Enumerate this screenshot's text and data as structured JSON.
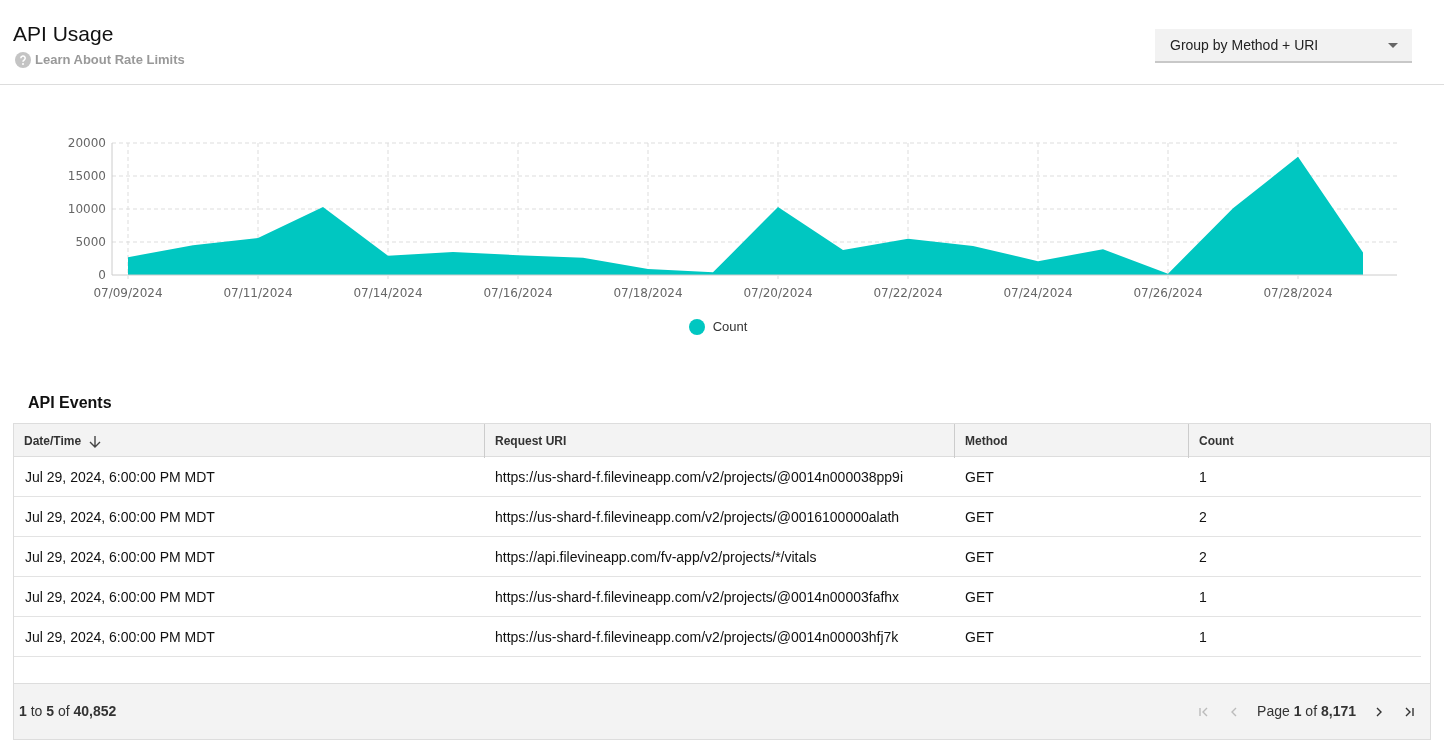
{
  "header": {
    "title": "API Usage",
    "help_link": "Learn About Rate Limits",
    "group_by": {
      "value": "Group by Method + URI"
    }
  },
  "usage_chart": {
    "chart_data": {
      "type": "area",
      "categories": [
        "07/09/2024",
        null,
        "07/11/2024",
        null,
        "07/14/2024",
        null,
        "07/16/2024",
        null,
        "07/18/2024",
        null,
        "07/20/2024",
        null,
        "07/22/2024",
        null,
        "07/24/2024",
        null,
        "07/26/2024",
        null,
        "07/28/2024",
        null
      ],
      "series": [
        {
          "name": "Count",
          "color": "#00c7c1",
          "values": [
            2700,
            4500,
            5600,
            10300,
            2900,
            3500,
            3000,
            2600,
            900,
            400,
            10300,
            3800,
            5500,
            4400,
            2100,
            3900,
            200,
            10100,
            17900,
            3400
          ]
        }
      ],
      "ylim": [
        0,
        20000
      ],
      "yticks": [
        0,
        5000,
        10000,
        15000,
        20000
      ],
      "grid": true
    }
  },
  "events": {
    "title": "API Events",
    "columns": [
      {
        "label": "Date/Time",
        "sorted": true
      },
      {
        "label": "Request URI",
        "sorted": false
      },
      {
        "label": "Method",
        "sorted": false
      },
      {
        "label": "Count",
        "sorted": false
      }
    ],
    "rows": [
      [
        "Jul 29, 2024, 6:00:00 PM MDT",
        "https://us-shard-f.filevineapp.com/v2/projects/@0014n000038pp9i",
        "GET",
        "1"
      ],
      [
        "Jul 29, 2024, 6:00:00 PM MDT",
        "https://us-shard-f.filevineapp.com/v2/projects/@0016100000alath",
        "GET",
        "2"
      ],
      [
        "Jul 29, 2024, 6:00:00 PM MDT",
        "https://api.filevineapp.com/fv-app/v2/projects/*/vitals",
        "GET",
        "2"
      ],
      [
        "Jul 29, 2024, 6:00:00 PM MDT",
        "https://us-shard-f.filevineapp.com/v2/projects/@0014n00003fafhx",
        "GET",
        "1"
      ],
      [
        "Jul 29, 2024, 6:00:00 PM MDT",
        "https://us-shard-f.filevineapp.com/v2/projects/@0014n00003hfj7k",
        "GET",
        "1"
      ]
    ],
    "summary": "**1** to **5** of **40,852**",
    "pager": {
      "page_text": "Page **1** of **8,171**"
    }
  }
}
